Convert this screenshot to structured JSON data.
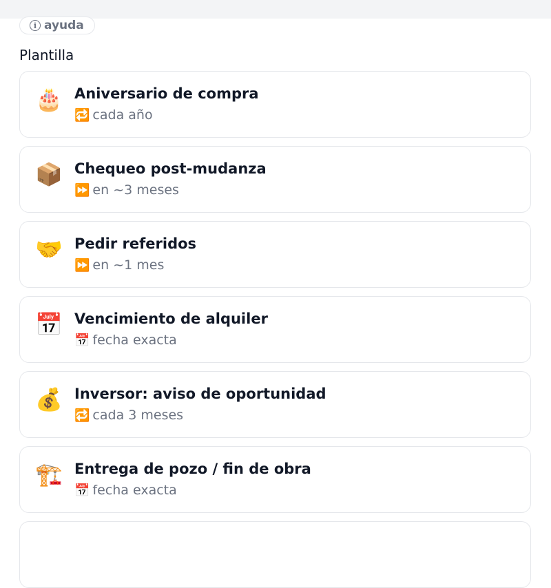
{
  "help": {
    "label": "ayuda",
    "icon": "info-icon"
  },
  "section_title": "Plantilla",
  "templates": [
    {
      "emoji": "🎂",
      "icon": "birthday-cake-icon",
      "title": "Aniversario de compra",
      "sub_icon": "🔁",
      "sub_icon_name": "repeat-icon",
      "sub": "cada año"
    },
    {
      "emoji": "📦",
      "icon": "package-icon",
      "title": "Chequeo post-mudanza",
      "sub_icon": "⏩",
      "sub_icon_name": "fast-forward-icon",
      "sub": "en ~3 meses"
    },
    {
      "emoji": "🤝",
      "icon": "handshake-icon",
      "title": "Pedir referidos",
      "sub_icon": "⏩",
      "sub_icon_name": "fast-forward-icon",
      "sub": "en ~1 mes"
    },
    {
      "emoji": "📅",
      "icon": "calendar-icon",
      "title": "Vencimiento de alquiler",
      "sub_icon": "📅",
      "sub_icon_name": "calendar-icon",
      "sub": "fecha exacta"
    },
    {
      "emoji": "💰",
      "icon": "money-bag-icon",
      "title": "Inversor: aviso de oportunidad",
      "sub_icon": "🔁",
      "sub_icon_name": "repeat-icon",
      "sub": "cada 3 meses"
    },
    {
      "emoji": "🏗️",
      "icon": "construction-crane-icon",
      "title": "Entrega de pozo / fin de obra",
      "sub_icon": "📅",
      "sub_icon_name": "calendar-icon",
      "sub": "fecha exacta"
    }
  ]
}
